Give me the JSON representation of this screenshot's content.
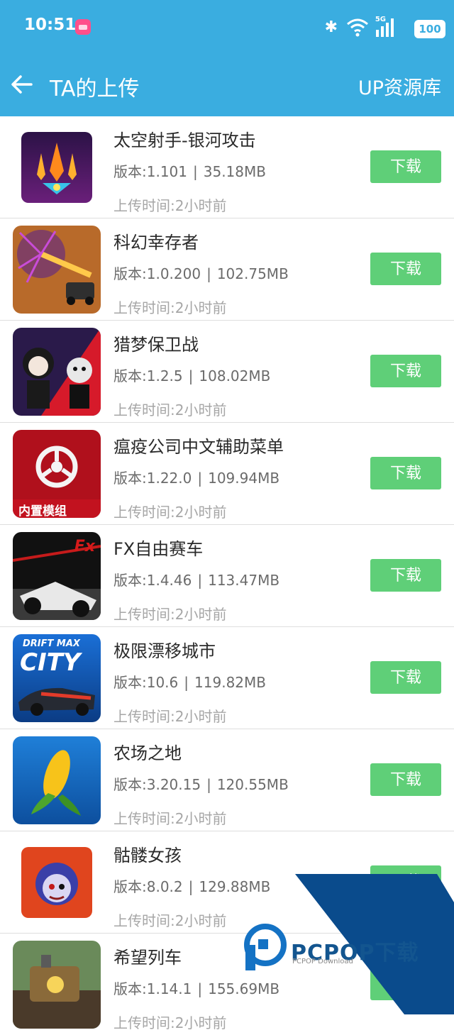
{
  "status_bar": {
    "time": "10:51",
    "network": "5G",
    "battery": "100"
  },
  "app_bar": {
    "title": "TA的上传",
    "action": "UP资源库"
  },
  "colors": {
    "primary": "#3aade0",
    "download_button": "#5fcf78"
  },
  "items": [
    {
      "name": "太空射手-银河攻击",
      "version": "版本:1.101",
      "size": "35.18MB",
      "time": "上传时间:2小时前",
      "button": "下载"
    },
    {
      "name": "科幻幸存者",
      "version": "版本:1.0.200",
      "size": "102.75MB",
      "time": "上传时间:2小时前",
      "button": "下载"
    },
    {
      "name": "猎梦保卫战",
      "version": "版本:1.2.5",
      "size": "108.02MB",
      "time": "上传时间:2小时前",
      "button": "下载"
    },
    {
      "name": "瘟疫公司中文辅助菜单",
      "version": "版本:1.22.0",
      "size": "109.94MB",
      "time": "上传时间:2小时前",
      "button": "下载",
      "icon_text": "内置模组"
    },
    {
      "name": "FX自由赛车",
      "version": "版本:1.4.46",
      "size": "113.47MB",
      "time": "上传时间:2小时前",
      "button": "下载",
      "icon_text": "Fx"
    },
    {
      "name": "极限漂移城市",
      "version": "版本:10.6",
      "size": "119.82MB",
      "time": "上传时间:2小时前",
      "button": "下载",
      "icon_text": "DRIFT MAX",
      "icon_text2": "CITY"
    },
    {
      "name": "农场之地",
      "version": "版本:3.20.15",
      "size": "120.55MB",
      "time": "上传时间:2小时前",
      "button": "下载"
    },
    {
      "name": "骷髅女孩",
      "version": "版本:8.0.2",
      "size": "129.88MB",
      "time": "上传时间:2小时前",
      "button": "下载"
    },
    {
      "name": "希望列车",
      "version": "版本:1.14.1",
      "size": "155.69MB",
      "time": "上传时间:2小时前",
      "button": "下载"
    }
  ],
  "watermark": {
    "text": "PCPOP下载",
    "sub": "PCPOP Download"
  }
}
